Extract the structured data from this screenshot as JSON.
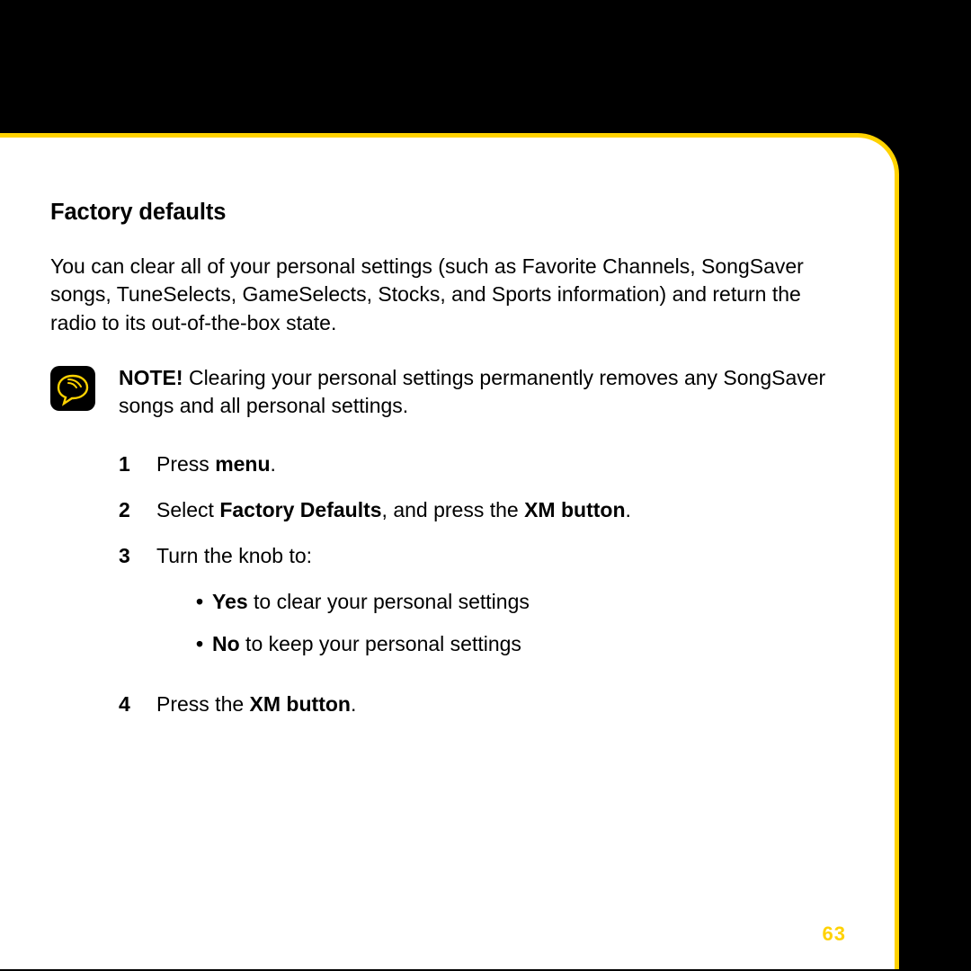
{
  "heading": "Factory defaults",
  "intro": "You can clear all of your personal settings (such as Favorite Channels, SongSaver songs, TuneSelects, GameSelects, Stocks, and Sports information) and return the radio to its out-of-the-box state.",
  "note": {
    "label": "NOTE!",
    "text": " Clearing your personal settings permanently removes any SongSaver songs and all personal settings."
  },
  "steps": {
    "s1": {
      "num": "1",
      "a": "Press ",
      "b": "menu",
      "c": "."
    },
    "s2": {
      "num": "2",
      "a": "Select ",
      "b": "Factory Defaults",
      "c": ", and press the ",
      "d": "XM button",
      "e": "."
    },
    "s3": {
      "num": "3",
      "a": "Turn the knob to:",
      "sub1": {
        "b": "Yes",
        "c": " to clear your personal settings"
      },
      "sub2": {
        "b": "No",
        "c": " to keep your personal settings"
      }
    },
    "s4": {
      "num": "4",
      "a": "Press the ",
      "b": "XM button",
      "c": "."
    }
  },
  "pageNumber": "63"
}
